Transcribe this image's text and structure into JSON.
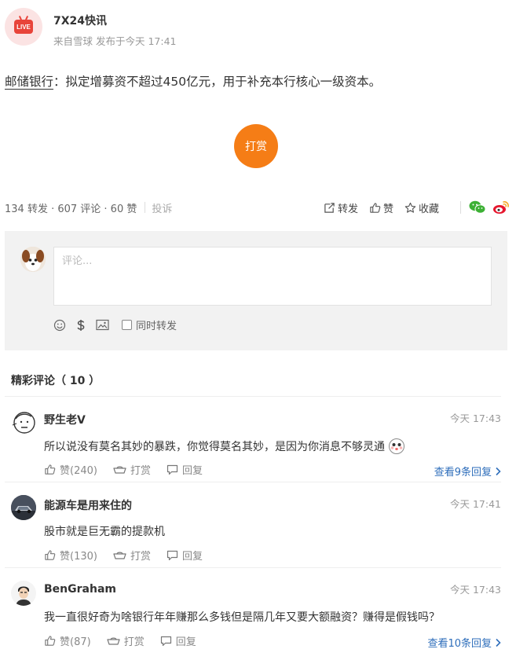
{
  "header": {
    "author": "7X24快讯",
    "meta": "来自雪球  发布于今天 17:41",
    "logo_text": "LIVE"
  },
  "post": {
    "stock_name": "邮储银行",
    "text": "：拟定增募资不超过450亿元，用于补充本行核心一级资本。"
  },
  "tip_button": "打赏",
  "stats": {
    "summary": "134 转发 · 607 评论 · 60 赞",
    "report": "投诉",
    "repost": "转发",
    "like": "赞",
    "favorite": "收藏"
  },
  "comment_box": {
    "placeholder": "评论...",
    "also_repost": "同时转发"
  },
  "section_title": "精彩评论（ 10 ）",
  "comments": [
    {
      "name": "野生老V",
      "time": "今天 17:43",
      "text": "所以说没有莫名其妙的暴跌，你觉得莫名其妙，是因为你消息不够灵通",
      "likes": "赞(240)",
      "tip": "打赏",
      "reply": "回复",
      "more": "查看9条回复"
    },
    {
      "name": "能源车是用来住的",
      "time": "今天 17:41",
      "text": "股市就是巨无霸的提款机",
      "likes": "赞(130)",
      "tip": "打赏",
      "reply": "回复",
      "more": ""
    },
    {
      "name": "BenGraham",
      "time": "今天 17:43",
      "text": "我一直很好奇为啥银行年年赚那么多钱但是隔几年又要大额融资？赚得是假钱吗？",
      "likes": "赞(87)",
      "tip": "打赏",
      "reply": "回复",
      "more": "查看10条回复"
    }
  ],
  "colors": {
    "accent_orange": "#f57d16",
    "live_red": "#e8443a",
    "link_blue": "#2e6ebb",
    "wechat_green": "#3cb034",
    "weibo_red": "#e6162d"
  }
}
